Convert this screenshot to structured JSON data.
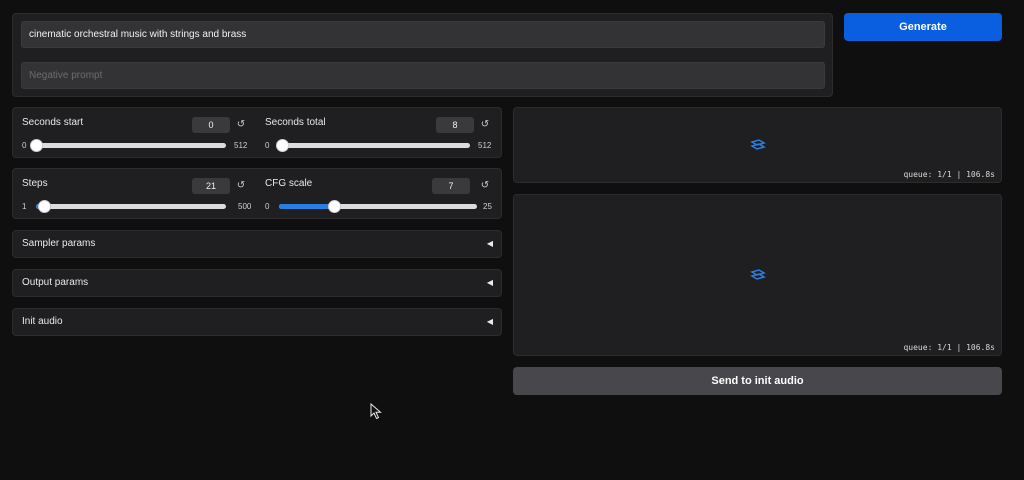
{
  "prompt": {
    "value": "cinematic orchestral music with strings and brass",
    "negative_placeholder": "Negative prompt"
  },
  "generate_label": "Generate",
  "sliders": {
    "seconds_start": {
      "label": "Seconds start",
      "value": "0",
      "min": "0",
      "max": "512",
      "fraction": 0.0
    },
    "seconds_total": {
      "label": "Seconds total",
      "value": "8",
      "min": "0",
      "max": "512",
      "fraction": 0.016
    },
    "steps": {
      "label": "Steps",
      "value": "21",
      "min": "1",
      "max": "500",
      "fraction": 0.04
    },
    "cfg_scale": {
      "label": "CFG scale",
      "value": "7",
      "min": "0",
      "max": "25",
      "fraction": 0.28
    }
  },
  "reset_glyph": "↺",
  "accordions": {
    "sampler": "Sampler params",
    "output": "Output params",
    "init_audio": "Init audio",
    "arrow": "◀"
  },
  "outputs": {
    "audio_queue": "queue: 1/1 | 106.8s",
    "spectrogram_queue": "queue: 1/1 | 106.8s"
  },
  "send_label": "Send to init audio",
  "colors": {
    "accent": "#0a5ee0",
    "slider_fill": "#2a7de1",
    "background": "#0f0f10",
    "panel": "#1f1f21"
  }
}
